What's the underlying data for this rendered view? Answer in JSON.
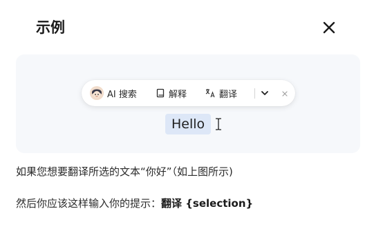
{
  "dialog": {
    "title": "示例"
  },
  "toolbar": {
    "items": [
      {
        "label": "AI 搜索",
        "icon": "ai-avatar-icon"
      },
      {
        "label": "解释",
        "icon": "book-icon"
      },
      {
        "label": "翻译",
        "icon": "translate-icon"
      }
    ],
    "more_icon": "chevron-down-icon",
    "close_icon": "close-icon"
  },
  "preview": {
    "selected_text": "Hello"
  },
  "explanation": {
    "line1": "如果您想要翻译所选的文本“你好”（如上图所示)",
    "line2_prefix": "然后你应该这样输入你的提示：",
    "line2_prompt": "翻译 {selection}"
  },
  "colors": {
    "preview_bg": "#f6f8fb",
    "selection_bg": "#dde7f7",
    "text": "#1f1f1f"
  }
}
